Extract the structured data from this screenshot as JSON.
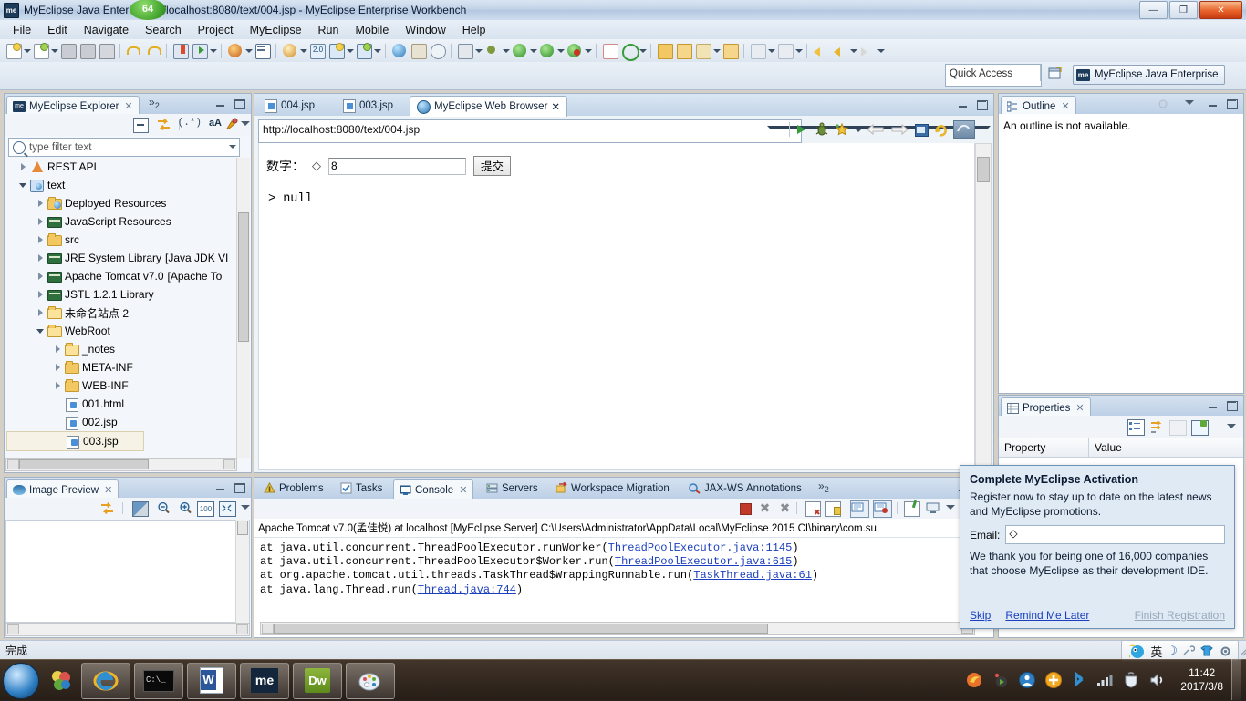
{
  "window": {
    "app_icon": "myeclipse-icon",
    "title": "MyEclipse Java Enter    - http://localhost:8080/text/004.jsp - MyEclipse Enterprise Workbench",
    "badge": "64",
    "minimize": "—",
    "restore": "❐",
    "close": "✕"
  },
  "menu": {
    "items": [
      {
        "label": "File"
      },
      {
        "label": "Edit"
      },
      {
        "label": "Navigate"
      },
      {
        "label": "Search"
      },
      {
        "label": "Project"
      },
      {
        "label": "MyEclipse"
      },
      {
        "label": "Run"
      },
      {
        "label": "Mobile"
      },
      {
        "label": "Window"
      },
      {
        "label": "Help"
      }
    ]
  },
  "quick_access": {
    "placeholder": "Quick Access",
    "value": "Quick Access",
    "open_perspective_icon": "open-perspective-icon",
    "perspective": {
      "icon": "me-icon",
      "label": "MyEclipse Java Enterprise"
    }
  },
  "explorer": {
    "tab_label": "MyEclipse Explorer",
    "tab_close": "✕",
    "overflow": "»",
    "overflow_count": "2",
    "toolbar_icons": [
      "collapse-all-icon",
      "link-with-editor-icon",
      "filter-regex-icon",
      "case-sensitive-icon",
      "customize-view-icon",
      "view-menu-icon"
    ],
    "filter_placeholder": "type filter text",
    "tree": [
      {
        "label": "REST API",
        "icon": "rest-api-icon",
        "indent": 0,
        "twist": "closed"
      },
      {
        "label": "text",
        "icon": "web-project-icon",
        "indent": 0,
        "twist": "open"
      },
      {
        "label": "Deployed Resources",
        "icon": "deployed-resources-icon",
        "indent": 1,
        "twist": "closed"
      },
      {
        "label": "JavaScript Resources",
        "icon": "library-icon",
        "indent": 1,
        "twist": "closed"
      },
      {
        "label": "src",
        "icon": "source-folder-icon",
        "indent": 1,
        "twist": "closed"
      },
      {
        "label": "JRE System Library",
        "suffix": "[Java JDK VI",
        "icon": "library-icon",
        "indent": 1,
        "twist": "closed"
      },
      {
        "label": "Apache Tomcat v7.0",
        "suffix": "[Apache To",
        "icon": "library-icon",
        "indent": 1,
        "twist": "closed"
      },
      {
        "label": "JSTL 1.2.1 Library",
        "icon": "library-icon",
        "indent": 1,
        "twist": "closed"
      },
      {
        "label": "未命名站点 2",
        "icon": "site-folder-icon",
        "indent": 1,
        "twist": "closed"
      },
      {
        "label": "WebRoot",
        "icon": "web-folder-icon",
        "indent": 1,
        "twist": "open"
      },
      {
        "label": "_notes",
        "icon": "folder-icon",
        "indent": 2,
        "twist": "closed"
      },
      {
        "label": "META-INF",
        "icon": "folder-icon",
        "indent": 2,
        "twist": "closed"
      },
      {
        "label": "WEB-INF",
        "icon": "folder-icon",
        "indent": 2,
        "twist": "closed"
      },
      {
        "label": "001.html",
        "icon": "html-file-icon",
        "indent": 2,
        "twist": "none"
      },
      {
        "label": "002.jsp",
        "icon": "jsp-file-icon",
        "indent": 2,
        "twist": "none"
      },
      {
        "label": "003.jsp",
        "icon": "jsp-file-icon",
        "indent": 2,
        "twist": "none",
        "selected": true
      }
    ]
  },
  "image_preview": {
    "tab_label": "Image Preview",
    "tab_close": "✕",
    "toolbar_icons": [
      "link-with-editor-icon",
      "transparency-icon",
      "zoom-out-icon",
      "zoom-in-icon",
      "actual-size-icon",
      "fit-to-window-icon",
      "view-menu-icon"
    ]
  },
  "editor": {
    "tabs": [
      {
        "label": "004.jsp",
        "icon": "jsp-file-icon",
        "active": false,
        "closable": false
      },
      {
        "label": "003.jsp",
        "icon": "jsp-file-icon",
        "active": false,
        "closable": false
      },
      {
        "label": "MyEclipse Web Browser",
        "icon": "browser-icon",
        "active": true,
        "closable": true,
        "close": "✕"
      }
    ],
    "url": "http://localhost:8080/text/004.jsp",
    "browser_toolbar_icons": [
      "run-icon",
      "debug-icon",
      "favorites-icon",
      "favorites-dropdown-icon",
      "back-icon",
      "forward-icon",
      "stop-icon",
      "refresh-icon",
      "open-external-browser-icon"
    ],
    "page": {
      "field_label": "数字：",
      "diamond_glyph": "◇",
      "input_value": "8",
      "submit_label": "提交",
      "output": "> null"
    }
  },
  "outline": {
    "tab_label": "Outline",
    "tab_close": "✕",
    "message": "An outline is not available.",
    "toolbar_icons": [
      "link-with-editor-icon",
      "view-menu-icon"
    ]
  },
  "properties": {
    "tab_label": "Properties",
    "tab_close": "✕",
    "toolbar_icons": [
      "show-categories-icon",
      "show-advanced-icon",
      "restore-default-icon",
      "new-property-icon",
      "view-menu-icon"
    ],
    "columns": [
      "Property",
      "Value"
    ]
  },
  "bottom_panel": {
    "tabs": [
      {
        "label": "Problems",
        "icon": "problems-icon",
        "active": false
      },
      {
        "label": "Tasks",
        "icon": "tasks-icon",
        "active": false
      },
      {
        "label": "Console",
        "icon": "console-icon",
        "active": true,
        "close": "✕"
      },
      {
        "label": "Servers",
        "icon": "servers-icon",
        "active": false
      },
      {
        "label": "Workspace Migration",
        "icon": "migration-icon",
        "active": false
      },
      {
        "label": "JAX-WS Annotations",
        "icon": "jaxws-icon",
        "active": false
      }
    ],
    "overflow": "»",
    "overflow_count": "2",
    "toolbar_icons": [
      "terminate-icon",
      "remove-launch-icon",
      "remove-all-terminated-icon",
      "clear-console-icon",
      "scroll-lock-icon",
      "show-console-on-output-icon",
      "show-console-on-error-icon",
      "pin-console-icon",
      "display-selected-console-icon",
      "console-dropdown-icon"
    ],
    "console_header": "Apache Tomcat v7.0(孟佳悦) at localhost [MyEclipse Server] C:\\Users\\Administrator\\AppData\\Local\\MyEclipse 2015 CI\\binary\\com.su",
    "console_lines": [
      {
        "prefix": "        at java.util.concurrent.ThreadPoolExecutor.runWorker(",
        "link": "ThreadPoolExecutor.java:1145",
        "suffix": ")"
      },
      {
        "prefix": "        at java.util.concurrent.ThreadPoolExecutor$Worker.run(",
        "link": "ThreadPoolExecutor.java:615",
        "suffix": ")"
      },
      {
        "prefix": "        at org.apache.tomcat.util.threads.TaskThread$WrappingRunnable.run(",
        "link": "TaskThread.java:61",
        "suffix": ")"
      },
      {
        "prefix": "        at java.lang.Thread.run(",
        "link": "Thread.java:744",
        "suffix": ")"
      }
    ]
  },
  "activation_popup": {
    "title": "Complete MyEclipse Activation",
    "body1": "Register now to stay up to date on the latest news and MyEclipse promotions.",
    "email_label": "Email:",
    "email_value": "◇",
    "body2": "We thank you for being one of 16,000 companies that choose MyEclipse as their development IDE.",
    "skip": "Skip",
    "remind": "Remind Me Later",
    "finish": "Finish Registration"
  },
  "status_bar": {
    "text": "完成"
  },
  "ime": {
    "logo": "ime-mascot-icon",
    "mode": "英",
    "moon": "☽",
    "tools": "tools-icon",
    "shirt": "skin-icon",
    "gear": "settings-icon"
  },
  "taskbar": {
    "start": "start-orb",
    "quick_launch": [
      "show-desktop-icon"
    ],
    "apps": [
      {
        "name": "internet-explorer-icon",
        "label": "e"
      },
      {
        "name": "command-prompt-icon",
        "label": "C:\\_"
      },
      {
        "name": "word-icon",
        "label": "W"
      },
      {
        "name": "myeclipse-icon",
        "label": "me"
      },
      {
        "name": "dreamweaver-icon",
        "label": "Dw"
      },
      {
        "name": "paint-icon",
        "label": "🎨"
      }
    ],
    "tray_icons": [
      "firefox-tray-icon",
      "media-tray-icon",
      "user-tray-icon",
      "update-tray-icon",
      "bluetooth-tray-icon",
      "network-tray-icon",
      "safety-tray-icon",
      "volume-tray-icon"
    ],
    "time": "11:42",
    "date": "2017/3/8"
  },
  "colors": {
    "accent": "#3a6ea5",
    "tab_active_bg": "#ffffff",
    "link": "#1b3fbf",
    "popup_bg": "#dfeaf5"
  }
}
